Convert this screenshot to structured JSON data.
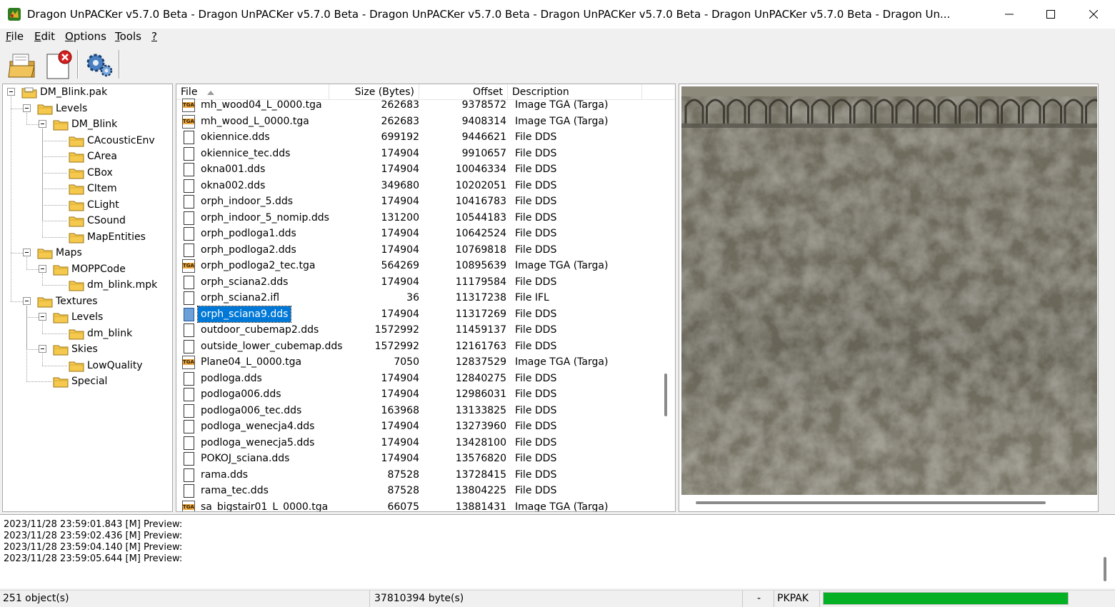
{
  "window": {
    "title": "Dragon UnPACKer v5.7.0 Beta - Dragon UnPACKer v5.7.0 Beta - Dragon UnPACKer v5.7.0 Beta - Dragon UnPACKer v5.7.0 Beta - Dragon UnPACKer v5.7.0 Beta - Dragon Un...",
    "controls": [
      "minimize",
      "maximize",
      "close"
    ]
  },
  "menu": {
    "items": [
      {
        "first": "F",
        "rest": "ile"
      },
      {
        "first": "E",
        "rest": "dit"
      },
      {
        "first": "O",
        "rest": "ptions"
      },
      {
        "first": "T",
        "rest": "ools"
      },
      {
        "first": "?",
        "rest": ""
      }
    ]
  },
  "toolbar": {
    "buttons": [
      "open-archive-icon",
      "close-archive-icon",
      "options-gear-icon"
    ]
  },
  "tree": {
    "nodes": [
      {
        "label": "DM_Blink.pak",
        "level": 0,
        "expanded": true,
        "icon": "archive-folder-icon"
      },
      {
        "label": "Levels",
        "level": 1,
        "expanded": true,
        "icon": "folder-icon"
      },
      {
        "label": "DM_Blink",
        "level": 2,
        "expanded": true,
        "icon": "folder-icon"
      },
      {
        "label": "CAcousticEnv",
        "level": 3,
        "icon": "folder-icon"
      },
      {
        "label": "CArea",
        "level": 3,
        "icon": "folder-icon"
      },
      {
        "label": "CBox",
        "level": 3,
        "icon": "folder-icon"
      },
      {
        "label": "CItem",
        "level": 3,
        "icon": "folder-icon"
      },
      {
        "label": "CLight",
        "level": 3,
        "icon": "folder-icon"
      },
      {
        "label": "CSound",
        "level": 3,
        "icon": "folder-icon"
      },
      {
        "label": "MapEntities",
        "level": 3,
        "icon": "folder-icon"
      },
      {
        "label": "Maps",
        "level": 1,
        "expanded": true,
        "icon": "folder-icon"
      },
      {
        "label": "MOPPCode",
        "level": 2,
        "expanded": true,
        "icon": "folder-icon"
      },
      {
        "label": "dm_blink.mpk",
        "level": 3,
        "icon": "folder-icon"
      },
      {
        "label": "Textures",
        "level": 1,
        "expanded": true,
        "icon": "folder-icon"
      },
      {
        "label": "Levels",
        "level": 2,
        "expanded": true,
        "icon": "folder-icon"
      },
      {
        "label": "dm_blink",
        "level": 3,
        "icon": "folder-icon"
      },
      {
        "label": "Skies",
        "level": 2,
        "expanded": true,
        "icon": "folder-icon"
      },
      {
        "label": "LowQuality",
        "level": 3,
        "icon": "folder-icon"
      },
      {
        "label": "Special",
        "level": 2,
        "icon": "folder-icon"
      }
    ]
  },
  "file_list": {
    "columns": {
      "file": "File",
      "size": "Size (Bytes)",
      "offset": "Offset",
      "description": "Description"
    },
    "sort": "file-ascending",
    "rows": [
      {
        "name": "mh_wood04_L_0000.tga",
        "size": "262683",
        "offset": "9378572",
        "desc": "Image TGA (Targa)",
        "type": "tga"
      },
      {
        "name": "mh_wood_L_0000.tga",
        "size": "262683",
        "offset": "9408314",
        "desc": "Image TGA (Targa)",
        "type": "tga"
      },
      {
        "name": "okiennice.dds",
        "size": "699192",
        "offset": "9446621",
        "desc": "File DDS",
        "type": "dds"
      },
      {
        "name": "okiennice_tec.dds",
        "size": "174904",
        "offset": "9910657",
        "desc": "File DDS",
        "type": "dds"
      },
      {
        "name": "okna001.dds",
        "size": "174904",
        "offset": "10046334",
        "desc": "File DDS",
        "type": "dds"
      },
      {
        "name": "okna002.dds",
        "size": "349680",
        "offset": "10202051",
        "desc": "File DDS",
        "type": "dds"
      },
      {
        "name": "orph_indoor_5.dds",
        "size": "174904",
        "offset": "10416783",
        "desc": "File DDS",
        "type": "dds"
      },
      {
        "name": "orph_indoor_5_nomip.dds",
        "size": "131200",
        "offset": "10544183",
        "desc": "File DDS",
        "type": "dds"
      },
      {
        "name": "orph_podloga1.dds",
        "size": "174904",
        "offset": "10642524",
        "desc": "File DDS",
        "type": "dds"
      },
      {
        "name": "orph_podloga2.dds",
        "size": "174904",
        "offset": "10769818",
        "desc": "File DDS",
        "type": "dds"
      },
      {
        "name": "orph_podloga2_tec.tga",
        "size": "564269",
        "offset": "10895639",
        "desc": "Image TGA (Targa)",
        "type": "tga"
      },
      {
        "name": "orph_sciana2.dds",
        "size": "174904",
        "offset": "11179584",
        "desc": "File DDS",
        "type": "dds"
      },
      {
        "name": "orph_sciana2.ifl",
        "size": "36",
        "offset": "11317238",
        "desc": "File IFL",
        "type": "dds"
      },
      {
        "name": "orph_sciana9.dds",
        "size": "174904",
        "offset": "11317269",
        "desc": "File DDS",
        "type": "dds",
        "selected": true
      },
      {
        "name": "outdoor_cubemap2.dds",
        "size": "1572992",
        "offset": "11459137",
        "desc": "File DDS",
        "type": "dds"
      },
      {
        "name": "outside_lower_cubemap.dds",
        "size": "1572992",
        "offset": "12161763",
        "desc": "File DDS",
        "type": "dds"
      },
      {
        "name": "Plane04_L_0000.tga",
        "size": "7050",
        "offset": "12837529",
        "desc": "Image TGA (Targa)",
        "type": "tga"
      },
      {
        "name": "podloga.dds",
        "size": "174904",
        "offset": "12840275",
        "desc": "File DDS",
        "type": "dds"
      },
      {
        "name": "podloga006.dds",
        "size": "174904",
        "offset": "12986031",
        "desc": "File DDS",
        "type": "dds"
      },
      {
        "name": "podloga006_tec.dds",
        "size": "163968",
        "offset": "13133825",
        "desc": "File DDS",
        "type": "dds"
      },
      {
        "name": "podloga_wenecja4.dds",
        "size": "174904",
        "offset": "13273960",
        "desc": "File DDS",
        "type": "dds"
      },
      {
        "name": "podloga_wenecja5.dds",
        "size": "174904",
        "offset": "13428100",
        "desc": "File DDS",
        "type": "dds"
      },
      {
        "name": "POKOJ_sciana.dds",
        "size": "174904",
        "offset": "13576820",
        "desc": "File DDS",
        "type": "dds"
      },
      {
        "name": "rama.dds",
        "size": "87528",
        "offset": "13728415",
        "desc": "File DDS",
        "type": "dds"
      },
      {
        "name": "rama_tec.dds",
        "size": "87528",
        "offset": "13804225",
        "desc": "File DDS",
        "type": "dds"
      },
      {
        "name": "sa_bigstair01_L_0000.tga",
        "size": "66075",
        "offset": "13881431",
        "desc": "Image TGA (Targa)",
        "type": "tga"
      }
    ]
  },
  "preview": {
    "image": "stone-wall-texture",
    "colors": {
      "base": "#6e6a5c",
      "light": "#a7a394",
      "dark": "#3b3a33"
    }
  },
  "log": {
    "lines": [
      "2023/11/28 23:59:01.843 [M] Preview:",
      "2023/11/28 23:59:02.436 [M] Preview:",
      "2023/11/28 23:59:04.140 [M] Preview:",
      "2023/11/28 23:59:05.644 [M] Preview:"
    ]
  },
  "status": {
    "objects": "251 object(s)",
    "bytes": "37810394 byte(s)",
    "dash": "-",
    "format": "PKPAK",
    "progress": 1.0,
    "progress_color": "#06b025"
  }
}
